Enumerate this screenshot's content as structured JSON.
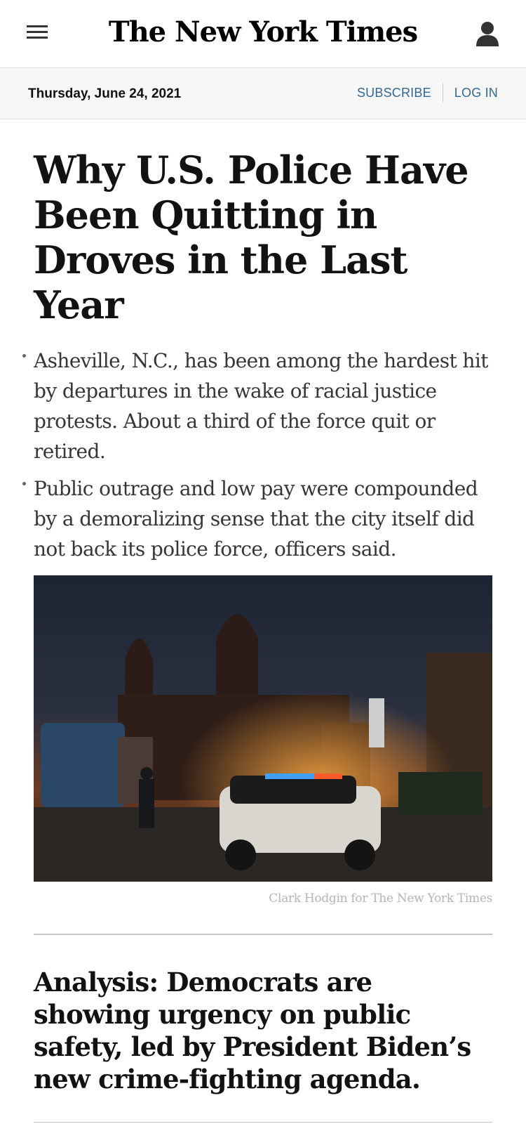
{
  "header": {
    "masthead": "The New York Times",
    "menu_icon": "hamburger-menu-icon",
    "account_icon": "user-account-icon"
  },
  "subbar": {
    "date": "Thursday, June 24, 2021",
    "subscribe_label": "SUBSCRIBE",
    "login_label": "LOG IN"
  },
  "article": {
    "headline": "Why U.S. Police Have Been Quitting in Droves in the Last Year",
    "summary": [
      "Asheville, N.C., has been among the hardest hit by departures in the wake of racial justice protests. About a third of the force quit or retired.",
      "Public outrage and low pay were compounded by a demoralizing sense that the city itself did not back its police force, officers said."
    ],
    "photo_credit": "Clark Hodgin for The New York Times"
  },
  "next_story": {
    "headline": "Analysis: Democrats are showing urgency on public safety, led by President Biden’s new crime-fighting agenda."
  },
  "colors": {
    "link": "#326891",
    "text": "#121212",
    "subbar_bg": "#f7f7f7"
  }
}
